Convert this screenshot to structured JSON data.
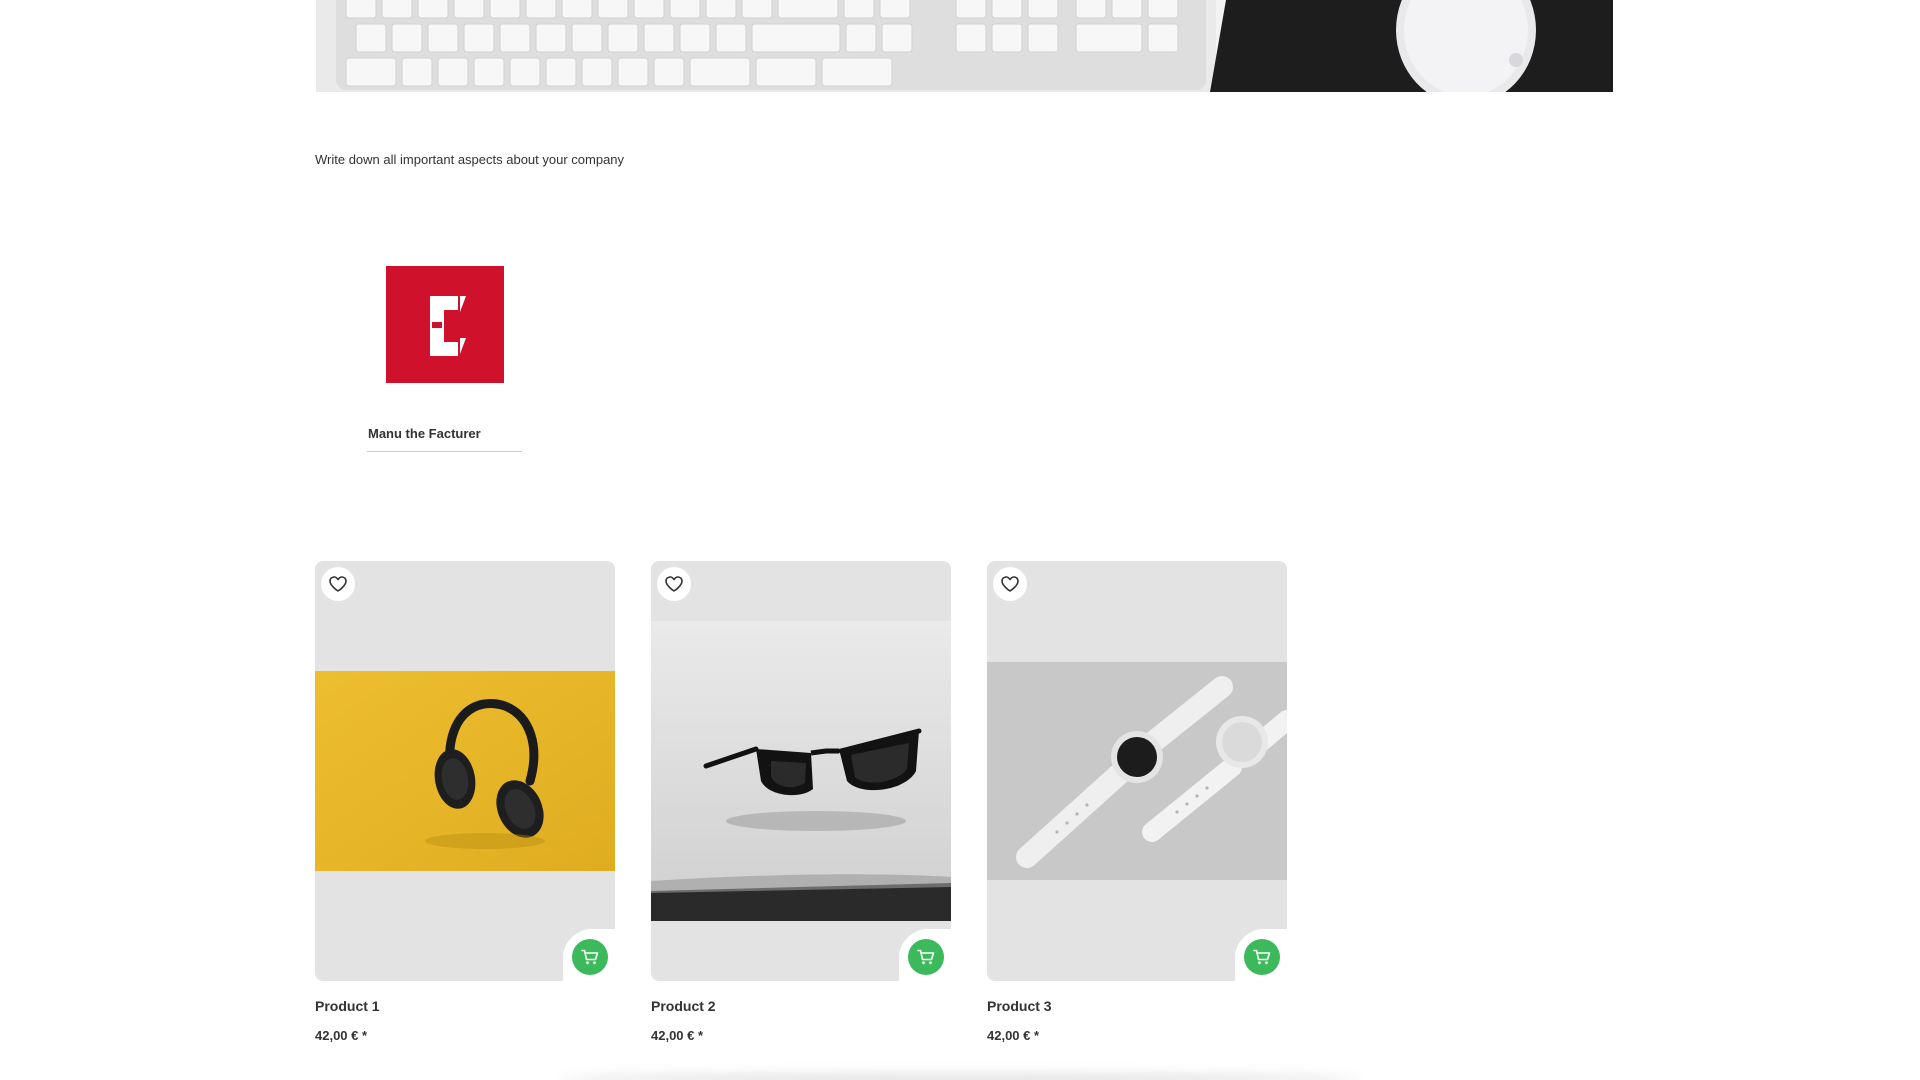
{
  "intro": {
    "text": "Write down all important aspects about your company"
  },
  "manufacturer": {
    "name": "Manu the Facturer",
    "logo_color": "#d0112b",
    "logo_letter": "C"
  },
  "products": [
    {
      "title": "Product 1",
      "price": "42,00 € *",
      "image": "headphones-on-yellow",
      "wishlist_icon": "heart-icon",
      "cart_icon": "cart-icon"
    },
    {
      "title": "Product 2",
      "price": "42,00 € *",
      "image": "black-sunglasses",
      "wishlist_icon": "heart-icon",
      "cart_icon": "cart-icon"
    },
    {
      "title": "Product 3",
      "price": "42,00 € *",
      "image": "white-smartwatches",
      "wishlist_icon": "heart-icon",
      "cart_icon": "cart-icon"
    }
  ],
  "colors": {
    "accent_green": "#3cb95b",
    "card_bg": "#e3e3e3",
    "text": "#333333"
  }
}
